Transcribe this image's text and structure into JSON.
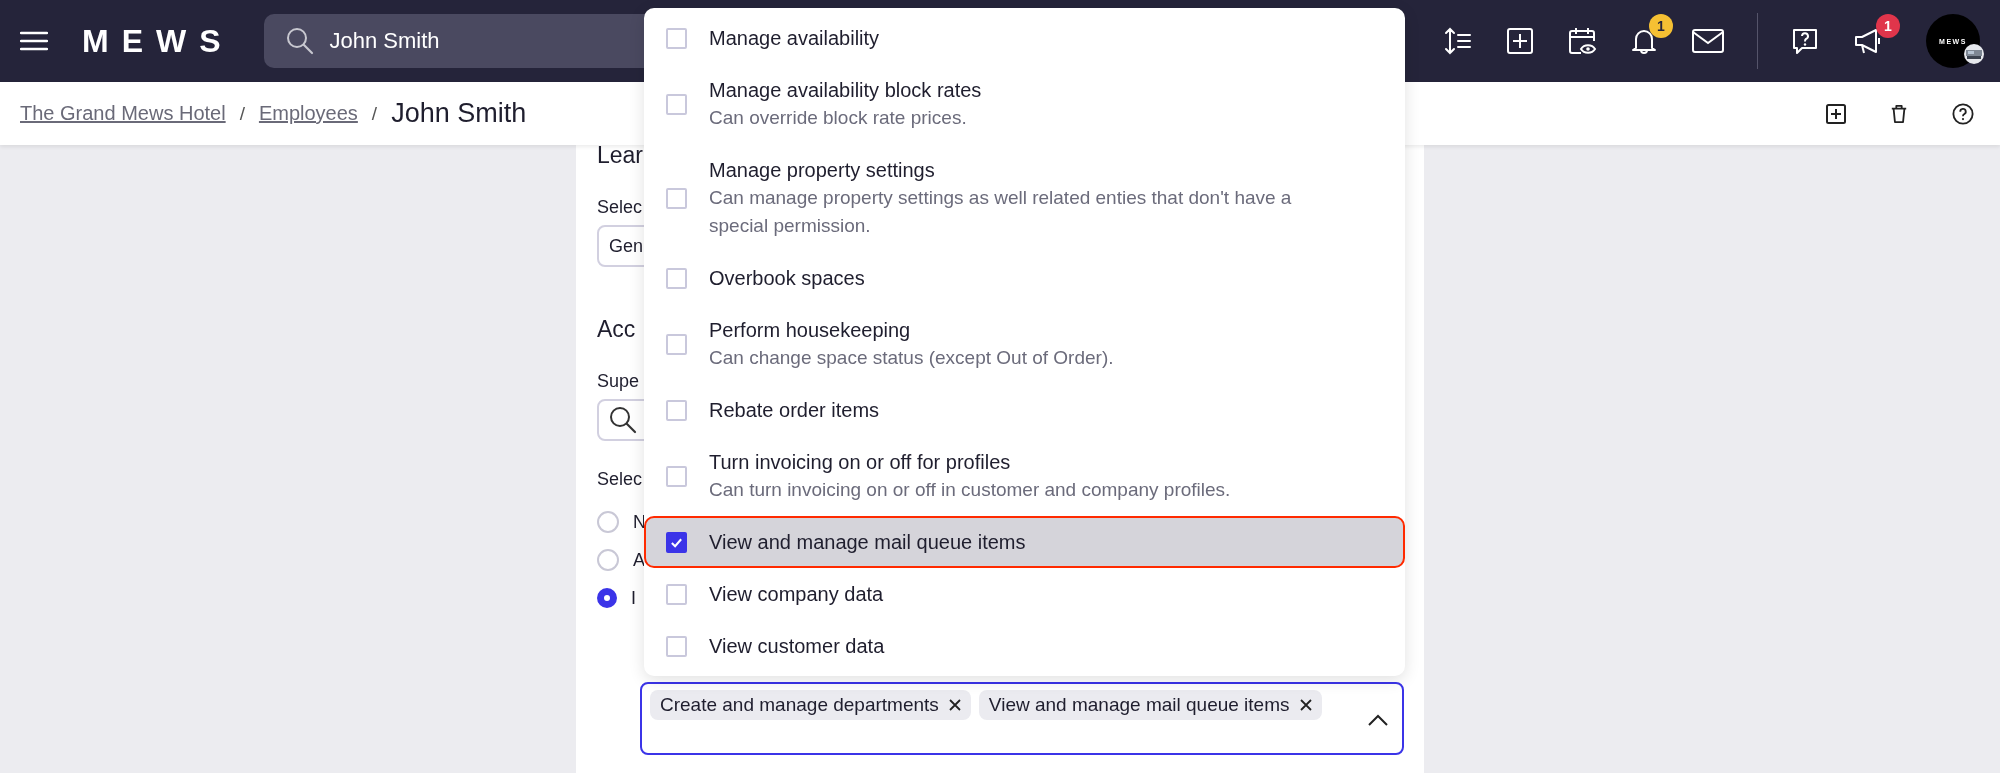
{
  "top_bar": {
    "logo": "MEWS",
    "search": {
      "value": "John Smith"
    },
    "notifications_badge": "1",
    "announcements_badge": "1",
    "avatar_text": "MEWS"
  },
  "breadcrumb": {
    "links": [
      "The Grand Mews Hotel",
      "Employees"
    ],
    "separators": [
      "/",
      "/"
    ],
    "title": "John Smith"
  },
  "form": {
    "heading_1": "Lear",
    "label_1": "Selec",
    "field_1": {
      "value": "Gen"
    },
    "heading_2": "Acc",
    "label_2": "Supe",
    "label_3": "Selec",
    "radios": [
      {
        "label": "N",
        "selected": false
      },
      {
        "label": "A",
        "selected": false
      },
      {
        "label": "I",
        "selected": true
      }
    ],
    "tags": [
      "Create and manage departments",
      "View and manage mail queue items"
    ]
  },
  "dropdown": {
    "items": [
      {
        "title": "Manage availability",
        "checked": false,
        "selected": false
      },
      {
        "title": "Manage availability block rates",
        "description": "Can override block rate prices.",
        "checked": false,
        "selected": false
      },
      {
        "title": "Manage property settings",
        "description": "Can manage property settings as well related enties that don't have a special permission.",
        "checked": false,
        "selected": false
      },
      {
        "title": "Overbook spaces",
        "checked": false,
        "selected": false
      },
      {
        "title": "Perform housekeeping",
        "description": "Can change space status (except Out of Order).",
        "checked": false,
        "selected": false
      },
      {
        "title": "Rebate order items",
        "checked": false,
        "selected": false
      },
      {
        "title": "Turn invoicing on or off for profiles",
        "description": "Can turn invoicing on or off in customer and company profiles.",
        "checked": false,
        "selected": false
      },
      {
        "title": "View and manage mail queue items",
        "checked": true,
        "selected": true
      },
      {
        "title": "View company data",
        "checked": false,
        "selected": false
      },
      {
        "title": "View customer data",
        "checked": false,
        "selected": false
      }
    ]
  }
}
